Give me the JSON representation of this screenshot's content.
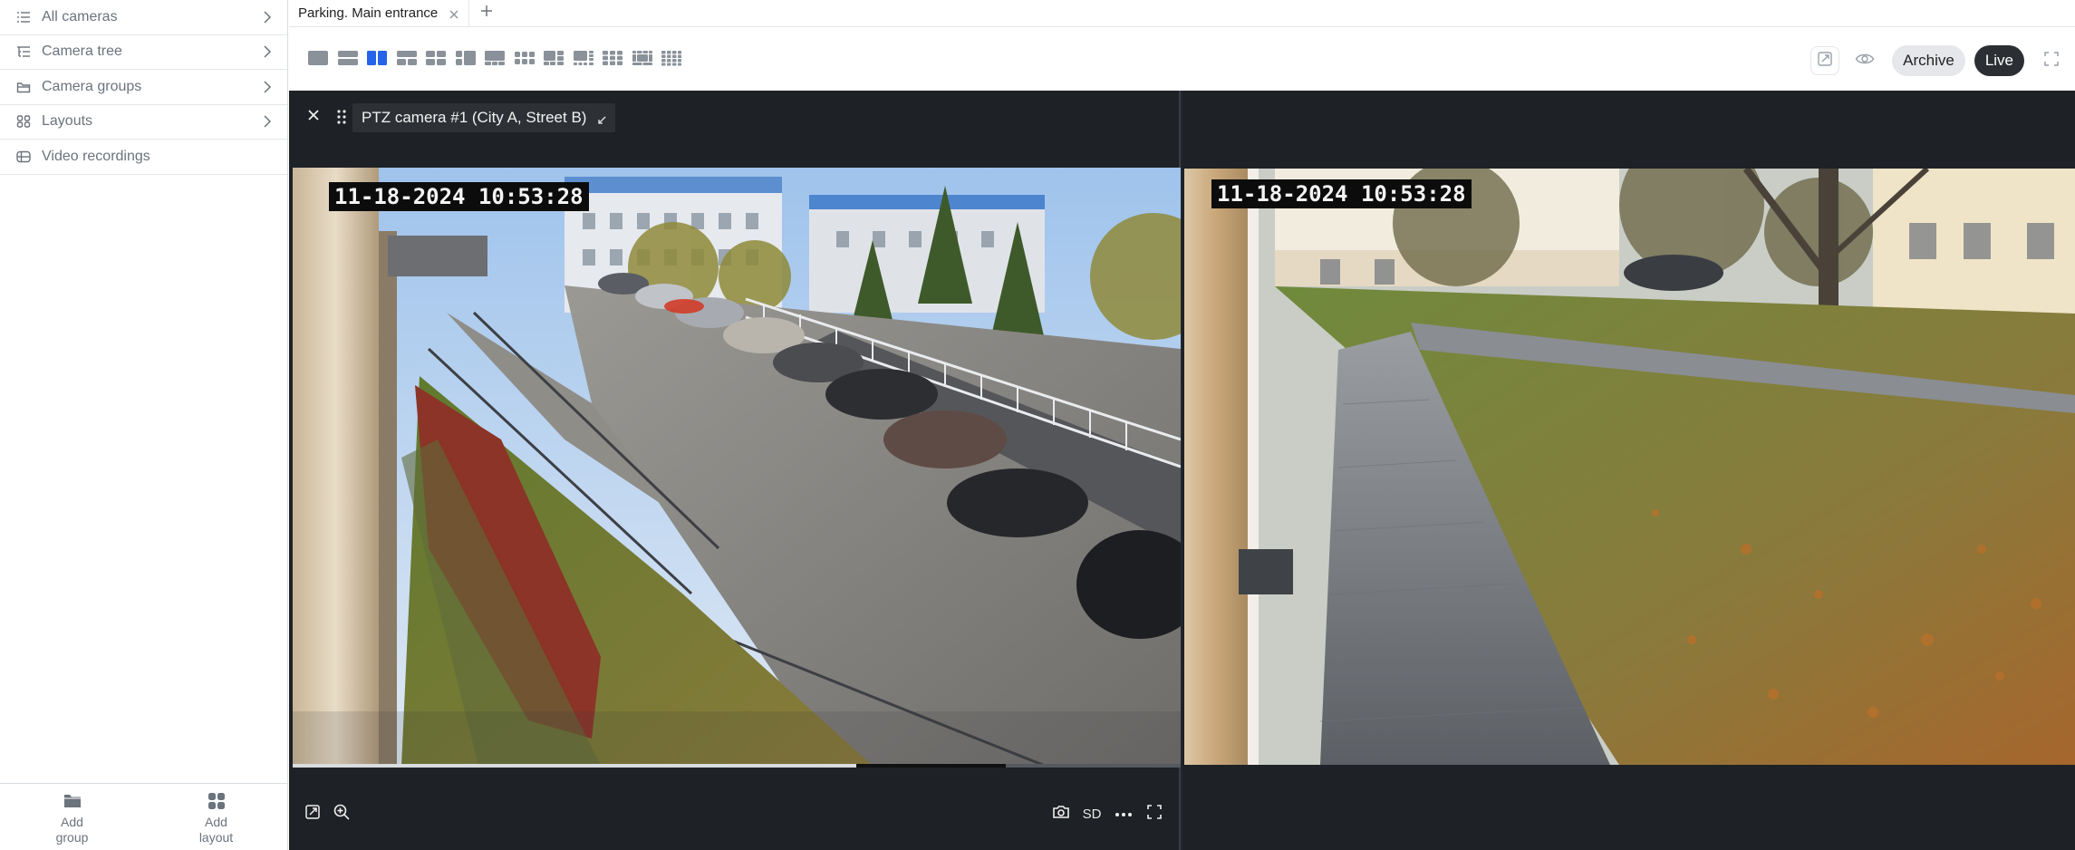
{
  "sidebar": {
    "items": [
      {
        "label": "All cameras",
        "icon": "list-icon",
        "chevron": true
      },
      {
        "label": "Camera tree",
        "icon": "tree-list-icon",
        "chevron": true
      },
      {
        "label": "Camera groups",
        "icon": "folder-icon",
        "chevron": true
      },
      {
        "label": "Layouts",
        "icon": "layout-grid-icon",
        "chevron": true
      },
      {
        "label": "Video recordings",
        "icon": "recordings-icon",
        "chevron": false
      }
    ],
    "footer": {
      "add_group": "Add\ngroup",
      "add_group_l1": "Add",
      "add_group_l2": "group",
      "add_layout_l1": "Add",
      "add_layout_l2": "layout"
    }
  },
  "tabs": [
    {
      "label": "Parking. Main entrance",
      "active": true
    }
  ],
  "toolbar": {
    "layouts": [
      "1x1",
      "2-rows",
      "2-cols",
      "1+2",
      "2x2",
      "1+3",
      "1+2-wide",
      "3x2",
      "1+5",
      "1+7",
      "3x3",
      "1+8",
      "4x4"
    ],
    "selected_layout": 2,
    "archive_label": "Archive",
    "live_label": "Live"
  },
  "cameras": [
    {
      "title": "PTZ camera #1 (City A, Street B)",
      "timestamp": "11-18-2024 10:53:28",
      "quality": "SD",
      "progress": 0.635
    },
    {
      "timestamp": "11-18-2024 10:53:28"
    }
  ],
  "colors": {
    "accent": "#2563eb",
    "grid_bg": "#1e2125",
    "live_bg": "#2b2f33",
    "archive_bg": "#e5e7eb"
  }
}
